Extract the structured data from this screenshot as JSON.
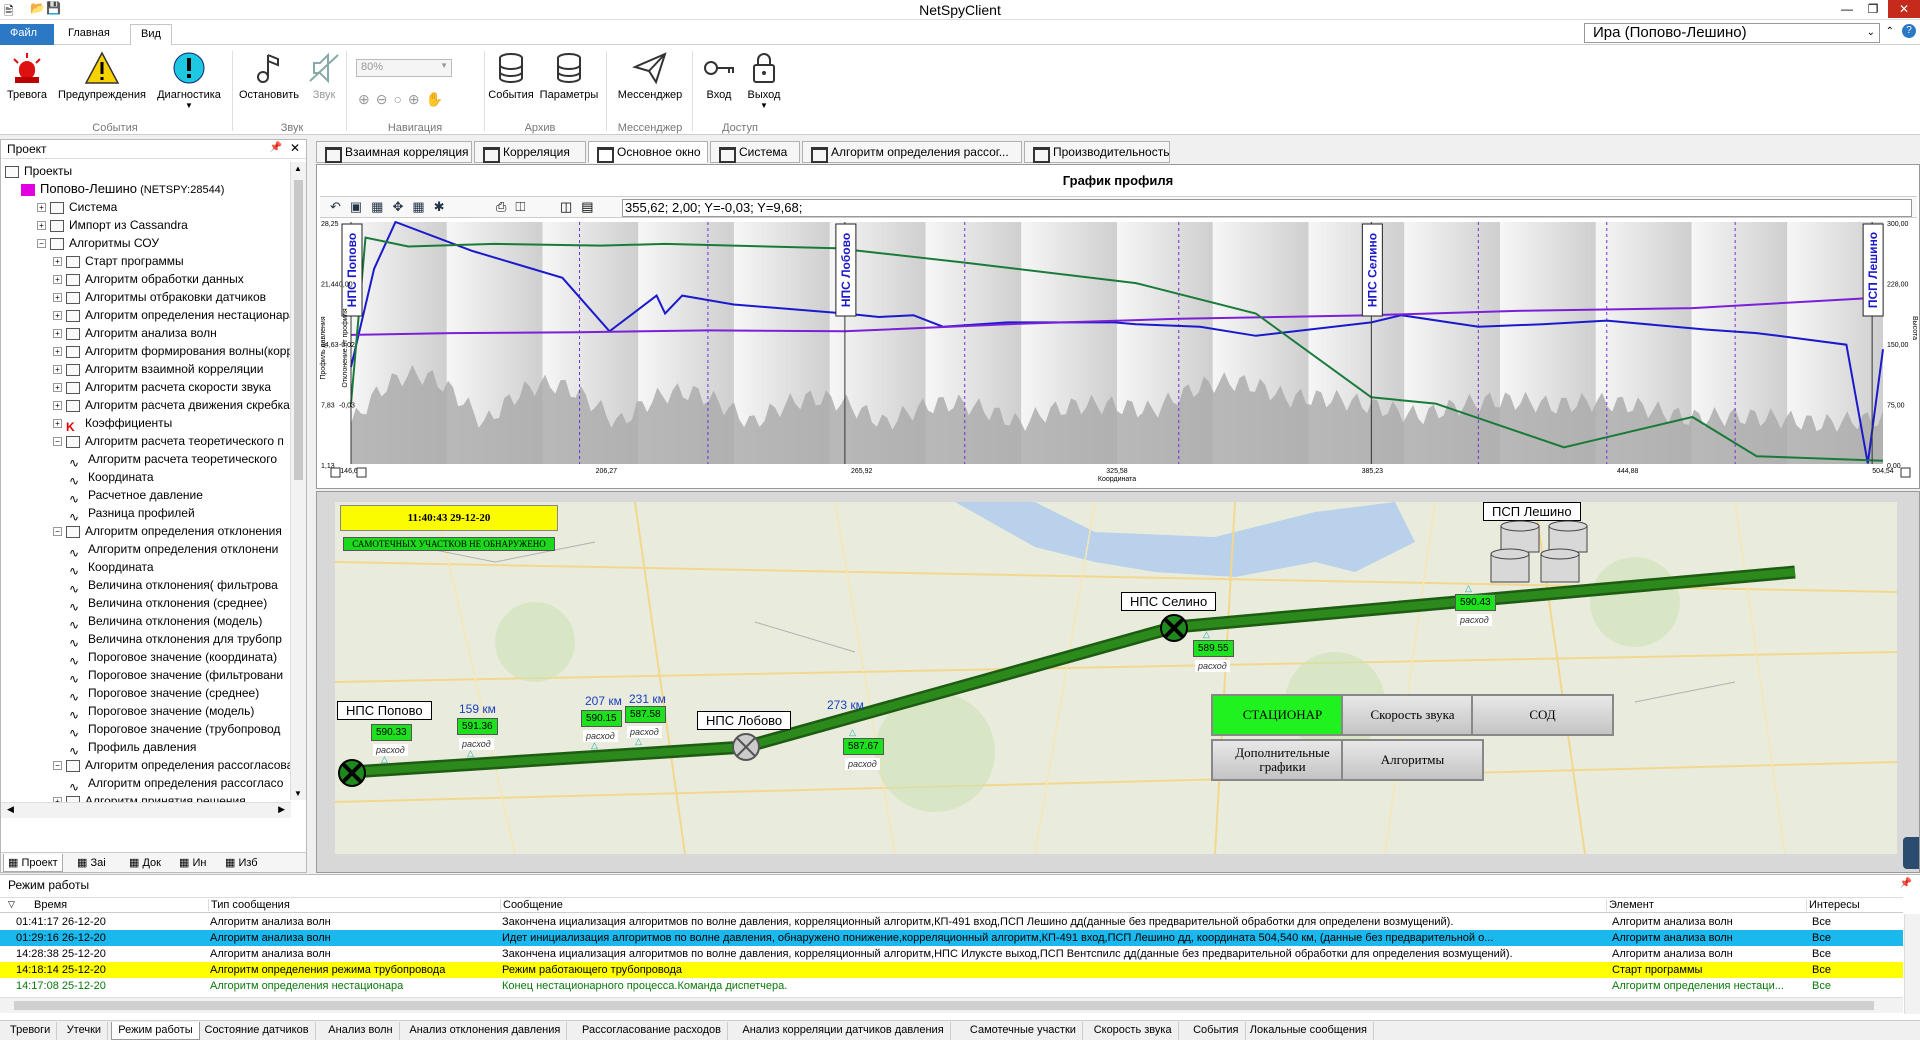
{
  "window": {
    "title": "NetSpyClient"
  },
  "menu": {
    "tabs": [
      "Файл",
      "Главная",
      "Вид"
    ],
    "profile": "Ира (Попово-Лешино)"
  },
  "ribbon": {
    "buttons": [
      "Тревога",
      "Предупреждения",
      "Диагностика",
      "Остановить",
      "Звук",
      "События",
      "Параметры",
      "Мессенджер",
      "Вход",
      "Выход"
    ],
    "zoom": "80%",
    "groups": [
      "События",
      "Звук",
      "Навигация",
      "Архив",
      "Мессенджер",
      "Доступ"
    ]
  },
  "project": {
    "title": "Проект",
    "items": [
      {
        "t": "Проекты",
        "l": 0
      },
      {
        "t": "Попово-Лешино",
        "s": " (NETSPY:28544)",
        "l": 1
      },
      {
        "t": "Система",
        "l": 2
      },
      {
        "t": "Импорт из Cassandra",
        "l": 2
      },
      {
        "t": "Алгоритмы СОУ",
        "l": 2
      },
      {
        "t": "Старт программы",
        "l": 3
      },
      {
        "t": "Алгоритм обработки данных",
        "l": 3
      },
      {
        "t": "Алгоритмы отбраковки датчиков",
        "l": 3
      },
      {
        "t": "Алгоритм определения нестационара",
        "l": 3
      },
      {
        "t": "Алгоритм анализа волн",
        "l": 3
      },
      {
        "t": "Алгоритм формирования волны(корр",
        "l": 3
      },
      {
        "t": "Алгоритм взаимной корреляции",
        "l": 3
      },
      {
        "t": "Алгоритм расчета скорости звука",
        "l": 3
      },
      {
        "t": "Алгоритм расчета движения скребка",
        "l": 3
      },
      {
        "t": "Коэффициенты",
        "l": 3
      },
      {
        "t": "Алгоритм  расчета  теоретического  п",
        "l": 3
      },
      {
        "t": "Алгоритм расчета теоретического",
        "l": 4
      },
      {
        "t": "Координата",
        "l": 4
      },
      {
        "t": "Расчетное давление",
        "l": 4
      },
      {
        "t": "Разница профилей",
        "l": 4
      },
      {
        "t": "Алгоритм  определения  отклонения",
        "l": 3
      },
      {
        "t": "Алгоритм определения отклонени",
        "l": 4
      },
      {
        "t": "Координата",
        "l": 4
      },
      {
        "t": "Величина отклонения( фильтрова",
        "l": 4
      },
      {
        "t": "Величина отклонения (среднее)",
        "l": 4
      },
      {
        "t": "Величина отклонения (модель)",
        "l": 4
      },
      {
        "t": "Величина отклонения для трубопр",
        "l": 4
      },
      {
        "t": "Пороговое значение (координата)",
        "l": 4
      },
      {
        "t": "Пороговое значение (фильтровани",
        "l": 4
      },
      {
        "t": "Пороговое значение (среднее)",
        "l": 4
      },
      {
        "t": "Пороговое значение (модель)",
        "l": 4
      },
      {
        "t": "Пороговое значение (трубопровод",
        "l": 4
      },
      {
        "t": "Профиль давления",
        "l": 4
      },
      {
        "t": "Алгоритм  определения рассогласова",
        "l": 3
      },
      {
        "t": "Алгоритм определения рассогласо",
        "l": 4
      },
      {
        "t": "Алгоритм принятия решения",
        "l": 3
      },
      {
        "t": "Объекты проекта",
        "l": 2
      }
    ],
    "tabs": [
      "Проект",
      "Заі",
      "Док",
      "Ин",
      "Изб"
    ]
  },
  "doctabs": [
    "Взаимная корреляция",
    "Корреляция",
    "Основное окно",
    "Система",
    "Алгоритм определения рассог...",
    "Производительность"
  ],
  "chart_data": {
    "type": "line",
    "title": "График профиля",
    "readout": "355,62; 2,00; Y=-0,03; Y=9,68;",
    "xlabel": "Координата",
    "ylabel": "Профиль давления",
    "y2label": "Отклонение от профиля",
    "y3label": "Высота",
    "xticks": [
      "146,61",
      "206,27",
      "265,92",
      "325,58",
      "385,23",
      "444,88",
      "504,54"
    ],
    "yticks": [
      "28,25",
      "21,44",
      "14,63",
      "7,83",
      "1,13"
    ],
    "y2ticks": [
      "0,00",
      "-0,02",
      "-0,03"
    ],
    "y3ticks": [
      "300,00",
      "228,00",
      "150,00",
      "75,00",
      "0,00"
    ],
    "xlim": [
      146.61,
      504.54
    ],
    "ylim": [
      1.13,
      28.25
    ],
    "stations": [
      {
        "name": "НПС Попово",
        "x": 146.61
      },
      {
        "name": "НПС Лобово",
        "x": 262
      },
      {
        "name": "НПС Селино",
        "x": 385
      },
      {
        "name": "ПСП Лешино",
        "x": 502
      }
    ],
    "series": [
      {
        "color": "#1a1acc",
        "x": [
          146.61,
          152,
          157,
          175,
          196,
          207,
          218,
          220,
          224,
          236,
          262,
          270,
          278,
          285,
          300,
          325,
          330,
          345,
          358,
          385,
          392,
          410,
          425,
          440,
          463,
          475,
          480,
          496,
          501,
          504.54
        ],
        "y": [
          12,
          23,
          28.25,
          25,
          22,
          16,
          20,
          18,
          20,
          19,
          18,
          17.6,
          17.8,
          16.5,
          17,
          17,
          16.8,
          16.5,
          15.5,
          17,
          17.8,
          16.5,
          16.8,
          17.2,
          16.2,
          15.8,
          15.5,
          14.5,
          1.2,
          14
        ]
      },
      {
        "color": "#7a20d8",
        "x": [
          146.61,
          170,
          200,
          230,
          262,
          300,
          340,
          385,
          420,
          460,
          504.54
        ],
        "y": [
          15.6,
          15.8,
          15.9,
          16.1,
          16.0,
          16.8,
          17.4,
          17.8,
          18.3,
          18.6,
          19.8
        ]
      },
      {
        "color": "#1a7a3a",
        "x": [
          146.61,
          150,
          160,
          180,
          205,
          220,
          260,
          290,
          330,
          358,
          385,
          400,
          430,
          460,
          475,
          504.54
        ],
        "y": [
          7.9,
          26.5,
          25.5,
          25.8,
          25.6,
          25.8,
          25.3,
          23.7,
          21.4,
          18.0,
          8.6,
          7.9,
          3.0,
          6.4,
          2.0,
          1.5
        ]
      }
    ]
  },
  "map": {
    "datetime": "11:40:43 29-12-20",
    "status": "САМОТЕЧНЫХ УЧАСТКОВ НЕ ОБНАРУЖЕНО",
    "stations": [
      "НПС Попово",
      "НПС Лобово",
      "НПС Селино",
      "ПСП Лешино"
    ],
    "sensors": [
      "590.33",
      "591.36",
      "590.15",
      "587.58",
      "587.67",
      "589.55",
      "590.43"
    ],
    "sensor_label": "расход",
    "kms": [
      "159 км",
      "207 км",
      "231 км",
      "273 км"
    ],
    "buttons": [
      "СТАЦИОНАР",
      "Скорость звука",
      "СОД",
      "Дополнительные графики",
      "Алгоритмы"
    ]
  },
  "log": {
    "title": "Режим работы",
    "headers": [
      "Время",
      "Тип сообщения",
      "Сообщение",
      "Элемент",
      "Интересы"
    ],
    "rows": [
      {
        "time": "01:41:17 26-12-20",
        "type": "Алгоритм анализа волн",
        "msg": "Закончена ициализация алгоритмов по волне давления, корреляционный алгоритм,КП-491 вход,ПСП Лешино  дд(данные без предварительной обработки для определени возмущений).",
        "el": "Алгоритм анализа волн",
        "int": "Все"
      },
      {
        "time": "01:29:16 26-12-20",
        "type": "Алгоритм анализа волн",
        "msg": "Идет инициализация алгоритмов по волне давления, обнаружено понижение,корреляционный алгоритм,КП-491 вход,ПСП Лешино  дд, координата  504,540  км,  (данные без предварительной о...",
        "el": "Алгоритм анализа волн",
        "int": "Все"
      },
      {
        "time": "14:28:38 25-12-20",
        "type": "Алгоритм анализа волн",
        "msg": "Закончена ициализация алгоритмов по волне давления, корреляционный алгоритм,НПС Илукстe выход,ПСП Вентспилс дд(данные без предварительной обработки для определения возмущений).",
        "el": "Алгоритм анализа волн",
        "int": "Все"
      },
      {
        "time": "14:18:14 25-12-20",
        "type": "Алгоритм определения режима трубопровода",
        "msg": "Режим работающего трубопровода",
        "el": "Старт программы",
        "int": "Все"
      },
      {
        "time": "14:17:08 25-12-20",
        "type": "Алгоритм определения нестационара",
        "msg": "Конец нестационарного процесса.Команда диспетчера.",
        "el": "Алгоритм определения нестаци...",
        "int": "Все"
      }
    ]
  },
  "bottom_tabs": [
    "Тревоги",
    "Утечки",
    "Режим работы",
    "Состояние датчиков",
    "Анализ волн",
    "Анализ отклонения давления",
    "Рассогласование расходов",
    "Анализ корреляции датчиков давления",
    "Самотечные участки",
    "Скорость звука",
    "События",
    "Локальные сообщения"
  ]
}
